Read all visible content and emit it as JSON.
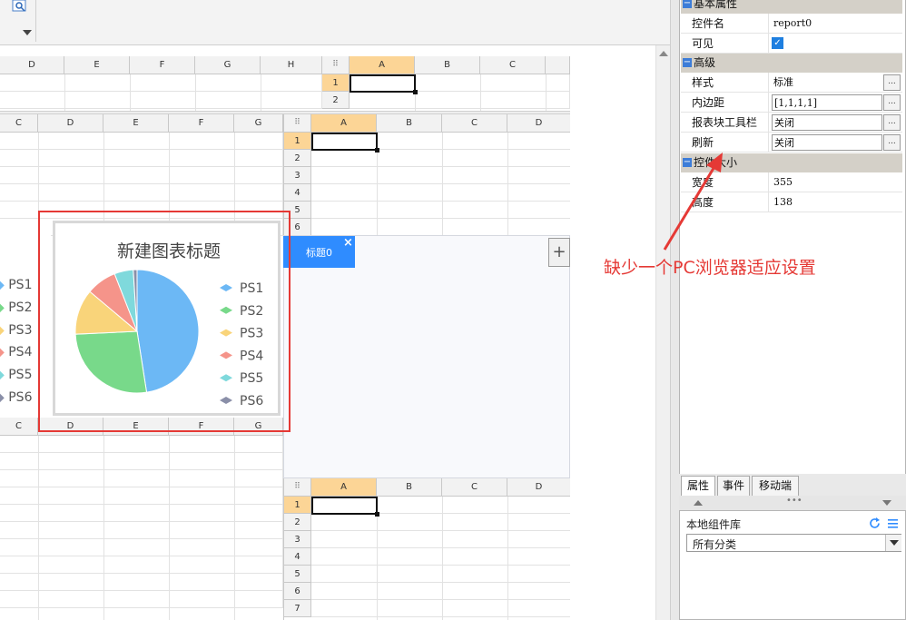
{
  "sheet_top": {
    "left_cols": [
      "D",
      "E",
      "F",
      "G",
      "H"
    ],
    "right_cols": [
      "A",
      "B",
      "C"
    ],
    "rows": [
      "1",
      "2"
    ]
  },
  "sheet_middle": {
    "left_cols": [
      "C",
      "D",
      "E",
      "F",
      "G"
    ],
    "right_cols": [
      "A",
      "B",
      "C",
      "D"
    ],
    "rows": [
      "1",
      "2",
      "3",
      "4",
      "5",
      "6"
    ]
  },
  "sheet_lower_left": {
    "cols": [
      "C",
      "D",
      "E",
      "F",
      "G"
    ]
  },
  "sheet_bottom": {
    "cols": [
      "A",
      "B",
      "C",
      "D"
    ],
    "rows": [
      "1",
      "2",
      "3",
      "4",
      "5",
      "6",
      "7"
    ]
  },
  "chart": {
    "legend_left": [
      "PS1",
      "PS2",
      "PS3",
      "PS4",
      "PS5",
      "PS6"
    ]
  },
  "chart_data": {
    "type": "pie",
    "title": "新建图表标题",
    "categories": [
      "PS1",
      "PS2",
      "PS3",
      "PS4",
      "PS5",
      "PS6"
    ],
    "values": [
      48,
      27,
      12,
      8,
      5,
      1
    ],
    "colors": [
      "#6cb8f5",
      "#78d98a",
      "#f9d47a",
      "#f5948a",
      "#7fd9dc",
      "#8a8fa8"
    ],
    "legend_position": "right"
  },
  "tab": {
    "title": "标题0",
    "close": "×",
    "add": "+"
  },
  "properties": {
    "group_basic": "基本属性",
    "group_advanced": "高级",
    "group_size": "控件大小",
    "rows": [
      {
        "name": "控件名",
        "value": "report0"
      },
      {
        "name": "可见",
        "value": "✓"
      },
      {
        "name": "样式",
        "value": "标准"
      },
      {
        "name": "内边距",
        "value": "[1,1,1,1]"
      },
      {
        "name": "报表块工具栏",
        "value": "关闭"
      },
      {
        "name": "刷新",
        "value": "关闭"
      },
      {
        "name": "宽度",
        "value": "355"
      },
      {
        "name": "高度",
        "value": "138"
      }
    ],
    "btn": "..."
  },
  "bottom_tabs": [
    "属性",
    "事件",
    "移动端"
  ],
  "library": {
    "title": "本地组件库",
    "category": "所有分类"
  },
  "annotation": {
    "text": "缺少一个PC浏览器适应设置",
    "color": "#e53935"
  }
}
